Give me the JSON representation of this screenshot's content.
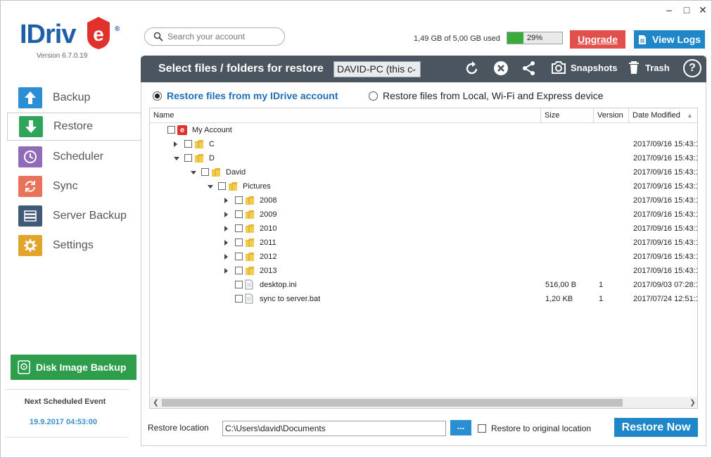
{
  "window": {
    "min": "–",
    "max": "□",
    "close": "✕"
  },
  "brand": {
    "name": "IDriv",
    "reg": "®",
    "version": "Version  6.7.0.19"
  },
  "search": {
    "placeholder": "Search your account"
  },
  "usage": {
    "text": "1,49 GB of 5,00 GB used",
    "percent": 29,
    "percent_label": "29%"
  },
  "upgrade_label": "Upgrade",
  "viewlogs_label": "View Logs",
  "sidebar": {
    "items": [
      {
        "label": "Backup",
        "icon": "upload-arrow-icon",
        "color": "#2b8fd4"
      },
      {
        "label": "Restore",
        "icon": "download-arrow-icon",
        "color": "#2ea55a"
      },
      {
        "label": "Scheduler",
        "icon": "clock-icon",
        "color": "#8f6bb8"
      },
      {
        "label": "Sync",
        "icon": "sync-icon",
        "color": "#e8735a"
      },
      {
        "label": "Server Backup",
        "icon": "server-icon",
        "color": "#425a7a"
      },
      {
        "label": "Settings",
        "icon": "gear-icon",
        "color": "#e3a42c"
      }
    ],
    "disk_image_label": "Disk Image Backup",
    "next_event_title": "Next Scheduled Event",
    "next_event_time": "19.9.2017 04:53:00"
  },
  "header": {
    "title": "Select files / folders for restore",
    "device": "DAVID-PC (this c",
    "snapshots": "Snapshots",
    "trash": "Trash",
    "help": "?"
  },
  "restore_source": {
    "option1": "Restore files from my IDrive account",
    "option2": "Restore files from Local, Wi-Fi and Express device",
    "selected": 1
  },
  "table": {
    "columns": [
      "Name",
      "Size",
      "Version",
      "Date Modified"
    ],
    "rows": [
      {
        "name": "My Account",
        "size": "",
        "version": "",
        "date": "",
        "type": "account",
        "level": 0,
        "expander": "none"
      },
      {
        "name": "C",
        "size": "",
        "version": "",
        "date": "2017/09/16 15:43:1",
        "type": "folder",
        "level": 1,
        "expander": "right"
      },
      {
        "name": "D",
        "size": "",
        "version": "",
        "date": "2017/09/16 15:43:1",
        "type": "folder",
        "level": 1,
        "expander": "down"
      },
      {
        "name": "David",
        "size": "",
        "version": "",
        "date": "2017/09/16 15:43:1",
        "type": "folder",
        "level": 2,
        "expander": "down"
      },
      {
        "name": "Pictures",
        "size": "",
        "version": "",
        "date": "2017/09/16 15:43:1",
        "type": "folder",
        "level": 3,
        "expander": "down"
      },
      {
        "name": "2008",
        "size": "",
        "version": "",
        "date": "2017/09/16 15:43:1",
        "type": "folder",
        "level": 4,
        "expander": "right"
      },
      {
        "name": "2009",
        "size": "",
        "version": "",
        "date": "2017/09/16 15:43:1",
        "type": "folder",
        "level": 4,
        "expander": "right"
      },
      {
        "name": "2010",
        "size": "",
        "version": "",
        "date": "2017/09/16 15:43:1",
        "type": "folder",
        "level": 4,
        "expander": "right"
      },
      {
        "name": "2011",
        "size": "",
        "version": "",
        "date": "2017/09/16 15:43:1",
        "type": "folder",
        "level": 4,
        "expander": "right"
      },
      {
        "name": "2012",
        "size": "",
        "version": "",
        "date": "2017/09/16 15:43:1",
        "type": "folder",
        "level": 4,
        "expander": "right"
      },
      {
        "name": "2013",
        "size": "",
        "version": "",
        "date": "2017/09/16 15:43:1",
        "type": "folder",
        "level": 4,
        "expander": "right"
      },
      {
        "name": "desktop.ini",
        "size": "516,00 B",
        "version": "1",
        "date": "2017/09/03 07:28:1",
        "type": "file",
        "level": 4,
        "expander": "none"
      },
      {
        "name": "sync to server.bat",
        "size": "1,20 KB",
        "version": "1",
        "date": "2017/07/24 12:51:1",
        "type": "file",
        "level": 4,
        "expander": "none"
      }
    ]
  },
  "restore_location": {
    "label": "Restore location",
    "value": "C:\\Users\\david\\Documents",
    "browse": "...",
    "original_label": "Restore to original location",
    "restore_now": "Restore Now"
  }
}
